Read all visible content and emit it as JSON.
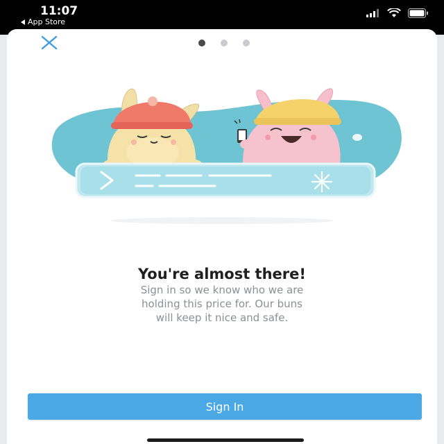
{
  "status_bar": {
    "time": "11:07",
    "back_label": "App Store",
    "icons": [
      "cellular-signal-icon",
      "wifi-icon",
      "battery-icon"
    ]
  },
  "modal": {
    "close_icon": "close-icon",
    "pagination": {
      "total": 3,
      "active_index": 0
    },
    "illustration": "two-bunnies-illustration",
    "headline": "You're almost there!",
    "body_lines": [
      "Sign in so we know who we are",
      "holding this price for. Our buns",
      "will keep it nice and safe."
    ],
    "sign_in_label": "Sign In"
  },
  "colors": {
    "accent": "#4aa9e4",
    "illustration_bg": "#6fc4d4",
    "headline": "#1f1f1f",
    "body_text": "#8b8f96"
  }
}
